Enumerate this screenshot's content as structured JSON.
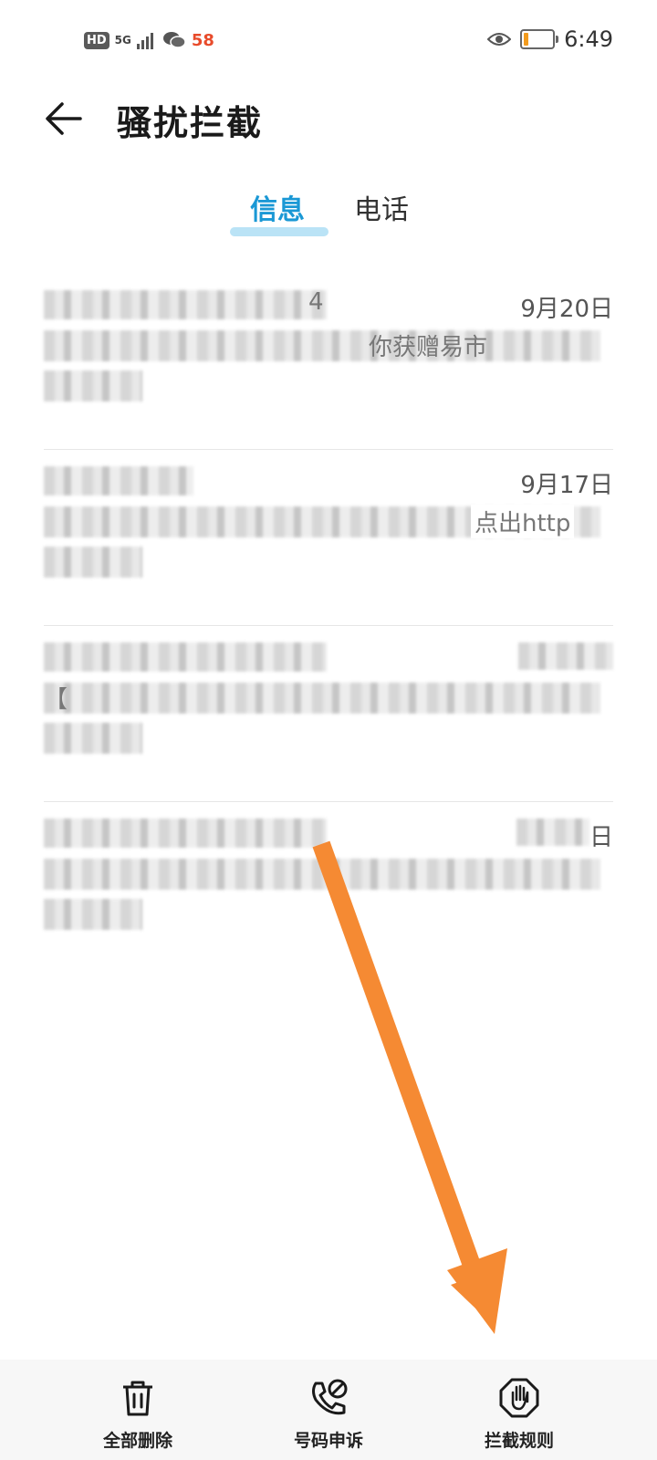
{
  "status_bar": {
    "hd": "HD",
    "network": "5G",
    "app_badge": "58",
    "time": "6:49",
    "battery_color": "#f29b1d"
  },
  "header": {
    "back_icon": "arrow-left-icon",
    "title": "骚扰拦截"
  },
  "tabs": {
    "messages": "信息",
    "calls": "电话",
    "active": "messages",
    "accent": "#1a98d5"
  },
  "messages": [
    {
      "sender_visible": "4",
      "date": "9月20日",
      "body_visible": "你获赠易市",
      "blurred": true
    },
    {
      "sender_visible": "",
      "date": "9月17日",
      "body_visible": "点出http",
      "blurred": true
    },
    {
      "sender_visible": "",
      "date": "",
      "body_visible": "【",
      "blurred": true
    },
    {
      "sender_visible": "",
      "date": "日",
      "body_visible": "",
      "blurred": true
    }
  ],
  "bottom_bar": {
    "delete_all": {
      "label": "全部删除",
      "icon": "trash-icon"
    },
    "number_appeal": {
      "label": "号码申诉",
      "icon": "phone-blocked-icon"
    },
    "block_rules": {
      "label": "拦截规则",
      "icon": "hand-stop-icon"
    }
  },
  "annotation": {
    "arrow_color": "#f58a33"
  }
}
